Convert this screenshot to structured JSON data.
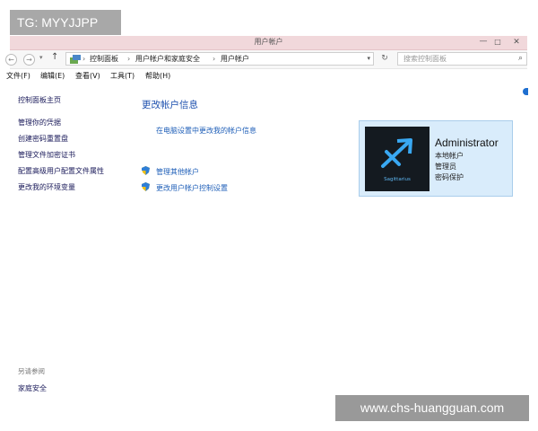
{
  "watermark": {
    "top": "TG: MYYJJPP",
    "bottom": "www.chs-huangguan.com"
  },
  "window": {
    "title": "用户帐户",
    "controls": {
      "minimize": "—",
      "maximize": "□",
      "close": "✕"
    }
  },
  "address": {
    "breadcrumb": [
      "控制面板",
      "用户帐户和家庭安全",
      "用户帐户"
    ],
    "separator": "›",
    "search_placeholder": "搜索控制面板"
  },
  "menu": [
    "文件(F)",
    "编辑(E)",
    "查看(V)",
    "工具(T)",
    "帮助(H)"
  ],
  "sidebar": {
    "items": [
      "控制面板主页",
      "管理你的凭据",
      "创建密码重置盘",
      "管理文件加密证书",
      "配置高级用户配置文件属性",
      "更改我的环境变量"
    ],
    "see_also_label": "另请参阅",
    "see_also_items": [
      "家庭安全"
    ]
  },
  "main": {
    "heading": "更改帐户信息",
    "pc_settings_link": "在电脑设置中更改我的帐户信息",
    "links": [
      "管理其他帐户",
      "更改用户帐户控制设置"
    ]
  },
  "account": {
    "name": "Administrator",
    "details": [
      "本地帐户",
      "管理员",
      "密码保护"
    ],
    "avatar_caption": "Sagittarius"
  },
  "colors": {
    "link": "#1f5fb8",
    "heading": "#1c4fae",
    "card_bg": "#d9ecfb",
    "titlebar": "#f1d8db"
  }
}
